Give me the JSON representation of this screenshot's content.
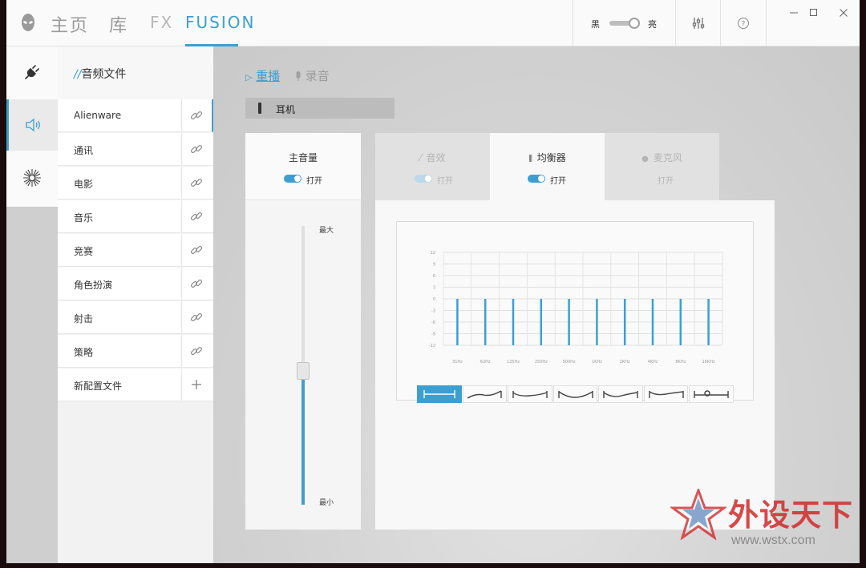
{
  "nav": {
    "home": "主页",
    "library": "库",
    "fx": "FX",
    "fusion": "FUSION"
  },
  "theme": {
    "dark_label": "黑",
    "light_label": "亮"
  },
  "rail": {
    "items": [
      "power-plug",
      "speaker",
      "light-burst"
    ]
  },
  "profiles": {
    "title_prefix": "//",
    "title": "音频文件",
    "items": [
      {
        "label": "Alienware",
        "icon": "link-icon"
      },
      {
        "label": "通讯",
        "icon": "link-icon"
      },
      {
        "label": "电影",
        "icon": "link-icon"
      },
      {
        "label": "音乐",
        "icon": "link-icon"
      },
      {
        "label": "竞赛",
        "icon": "link-icon"
      },
      {
        "label": "角色扮演",
        "icon": "link-icon"
      },
      {
        "label": "射击",
        "icon": "link-icon"
      },
      {
        "label": "策略",
        "icon": "link-icon"
      },
      {
        "label": "新配置文件",
        "icon": "plus-icon"
      }
    ]
  },
  "subtabs": {
    "playback": "重播",
    "recording": "录音"
  },
  "device": {
    "label": "耳机"
  },
  "master_volume": {
    "title": "主音量",
    "toggle_label": "打开",
    "max_label": "最大",
    "min_label": "最小",
    "level": 0.47
  },
  "effects": {
    "sound_fx": {
      "label": "音效",
      "toggle_label": "打开"
    },
    "equalizer": {
      "label": "均衡器",
      "toggle_label": "打开"
    },
    "microphone": {
      "label": "麦克风",
      "toggle_label": "打开"
    }
  },
  "equalizer": {
    "y_ticks": [
      "12",
      "9",
      "6",
      "3",
      "0",
      "-3",
      "-6",
      "-9",
      "-12"
    ],
    "bands": [
      "31Hz",
      "62Hz",
      "125Hz",
      "250Hz",
      "500Hz",
      "1KHz",
      "2KHz",
      "4KHz",
      "8KHz",
      "16KHz"
    ],
    "values": [
      0,
      0,
      0,
      0,
      0,
      0,
      0,
      0,
      0,
      0
    ],
    "presets": 7,
    "active_preset": 0
  },
  "watermark": {
    "text": "外设天下",
    "url": "www.wstx.com"
  },
  "colors": {
    "accent": "#3d9fd1",
    "watermark_red": "#d12b2b"
  }
}
